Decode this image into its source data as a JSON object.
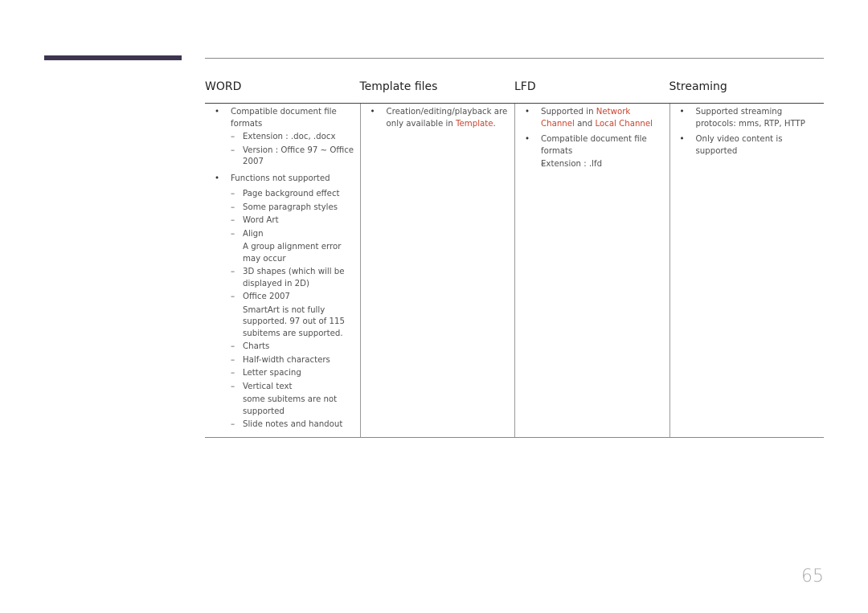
{
  "table": {
    "headers": [
      "WORD",
      "Template files",
      "LFD",
      "Streaming"
    ],
    "word": {
      "bullet1": "Compatible document file formats",
      "bullet1_items": [
        "Extension : .doc, .docx",
        "Version : Office 97 ~ Office 2007"
      ],
      "bullet2": "Functions not supported",
      "bullet2_items": [
        {
          "label": "Page background effect",
          "note": ""
        },
        {
          "label": "Some paragraph styles",
          "note": ""
        },
        {
          "label": "Word Art",
          "note": ""
        },
        {
          "label": "Align",
          "note": "A group alignment error may occur"
        },
        {
          "label": "3D shapes (which will be displayed in 2D)",
          "note": ""
        },
        {
          "label": "Office 2007",
          "note": "SmartArt is not fully supported. 97 out of 115 subitems are supported."
        },
        {
          "label": "Charts",
          "note": ""
        },
        {
          "label": "Half-width characters",
          "note": ""
        },
        {
          "label": "Letter spacing",
          "note": ""
        },
        {
          "label": "Vertical text",
          "note": "some subitems are not supported"
        },
        {
          "label": "Slide notes and handout",
          "note": ""
        }
      ]
    },
    "template": {
      "text_before": "Creation/editing/playback are only available in ",
      "highlight": "Template",
      "text_after": "."
    },
    "lfd": {
      "b1_pre": "Supported in ",
      "b1_hl1": "Network Channel",
      "b1_mid": " and ",
      "b1_hl2": "Local Channel",
      "b2": "Compatible document file formats",
      "b2_items": [
        "Extension : .lfd"
      ]
    },
    "streaming": {
      "bullets": [
        "Supported streaming protocols: mms, RTP, HTTP",
        "Only video content is supported"
      ]
    }
  },
  "page_number": "65",
  "colors": {
    "accent_bar": "#3d3550",
    "highlight": "#c8442e"
  }
}
